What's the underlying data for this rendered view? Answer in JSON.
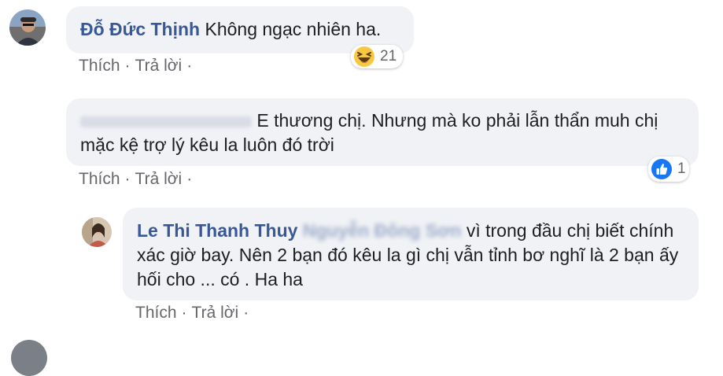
{
  "comments": [
    {
      "author": "Đỗ Đức Thịnh",
      "text": "Không ngạc nhiên ha.",
      "actions": {
        "like": "Thích",
        "reply": "Trả lời",
        "separator": "·"
      },
      "reaction": {
        "icon": "haha-emoji-icon",
        "count": "21"
      }
    },
    {
      "author": "",
      "text": "E thương chị. Nhưng mà ko phải lẫn thẩn muh chị mặc kệ trợ lý kêu la luôn đó trời",
      "actions": {
        "like": "Thích",
        "reply": "Trả lời",
        "separator": "·"
      },
      "reaction": {
        "icon": "like-icon",
        "count": "1"
      }
    },
    {
      "author": "Le Thi Thanh Thuy",
      "mention": "Nguyễn Đông Sơn",
      "text": " vì trong đầu chị biết chính xác giờ bay. Nên 2 bạn đó kêu la gì chị vẫn tỉnh bơ nghĩ là 2 bạn ấy hối cho ... có . Ha ha",
      "actions": {
        "like": "Thích",
        "reply": "Trả lời",
        "separator": "·"
      }
    }
  ],
  "colors": {
    "author": "#385898",
    "bubble": "#f0f2f5",
    "meta": "#65676b",
    "like_blue": "#1877f2",
    "haha_yellow": "#f7c844"
  }
}
